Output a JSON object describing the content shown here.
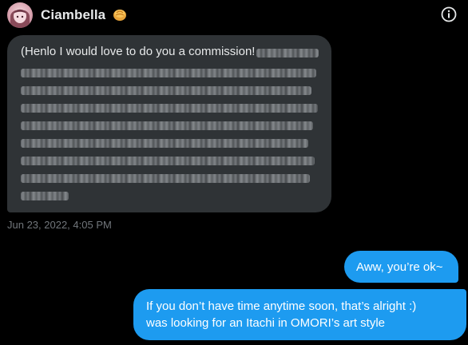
{
  "header": {
    "name": "Ciambella",
    "badge_icon": "bread-emoji-icon",
    "info_icon": "info-circle-icon"
  },
  "incoming": {
    "text": "(Henlo I would love to do you a commission!",
    "blurred": true,
    "timestamp": "Jun 23, 2022, 4:05 PM"
  },
  "outgoing": [
    {
      "text": "Aww, you’re ok~"
    },
    {
      "lines": [
        "If you don’t have time anytime soon, that’s alright :)",
        "was looking for an Itachi in OMORI’s art style"
      ]
    }
  ],
  "colors": {
    "background": "#000000",
    "incoming_bubble": "#2f3336",
    "outgoing_bubble": "#1d9bf0",
    "timestamp": "#71767b"
  }
}
